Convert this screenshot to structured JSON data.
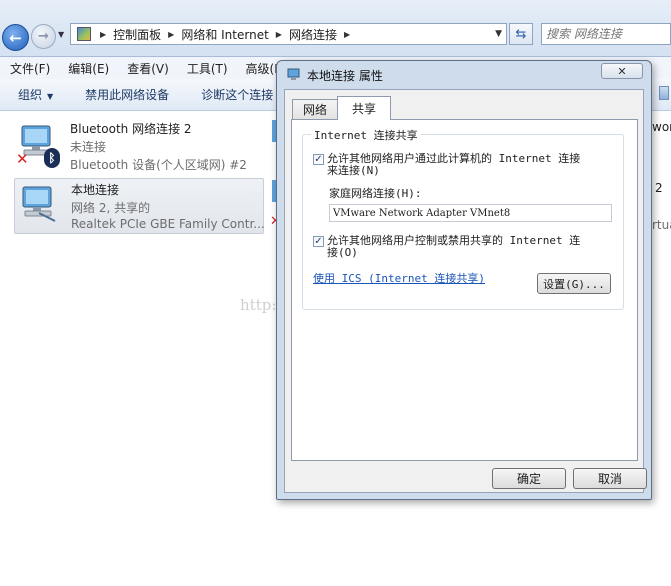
{
  "address": {
    "crumbs": [
      "控制面板",
      "网络和 Internet",
      "网络连接"
    ],
    "search_placeholder": "搜索 网络连接"
  },
  "menu": [
    "文件(F)",
    "编辑(E)",
    "查看(V)",
    "工具(T)",
    "高级(N)"
  ],
  "commands": {
    "organize": "组织",
    "disable": "禁用此网络设备",
    "diagnose": "诊断这个连接"
  },
  "connections": [
    {
      "name": "Bluetooth 网络连接 2",
      "status": "未连接",
      "device": "Bluetooth 设备(个人区域网) #2"
    },
    {
      "name": "本地连接",
      "status": "网络  2, 共享的",
      "device": "Realtek PCIe GBE Family Contr..."
    }
  ],
  "partial_right": [
    "wor",
    "2",
    "rtua"
  ],
  "watermark": "http://blog.csdn.net/",
  "dialog": {
    "title": "本地连接 属性",
    "tabs": [
      "网络",
      "共享"
    ],
    "group_label": "Internet 连接共享",
    "allow_connect": {
      "checked": true,
      "line1": "允许其他网络用户通过此计算机的 Internet 连接",
      "line2": "来连接(N)"
    },
    "home_label": "家庭网络连接(H):",
    "home_value": "VMware Network Adapter VMnet8",
    "allow_control": {
      "checked": true,
      "line1": "允许其他网络用户控制或禁用共享的 Internet 连",
      "line2": "接(O)"
    },
    "ics_link": "使用 ICS (Internet 连接共享)",
    "settings_btn": "设置(G)...",
    "ok_btn": "确定",
    "cancel_btn": "取消"
  }
}
